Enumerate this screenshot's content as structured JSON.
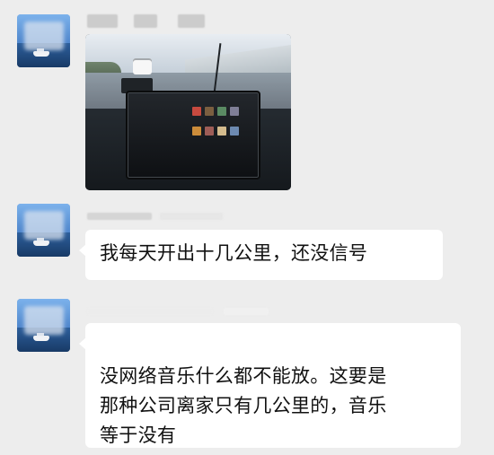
{
  "messages": [
    {
      "type": "image",
      "sender_name": "",
      "content": "",
      "note": ""
    },
    {
      "type": "text",
      "sender_name": "",
      "content": "我每天开出十几公里，还没信号"
    },
    {
      "type": "text",
      "sender_name": "",
      "content": "没网络音乐什么都不能放。这要是\n那种公司离家只有几公里的，音乐\n等于没有"
    }
  ]
}
